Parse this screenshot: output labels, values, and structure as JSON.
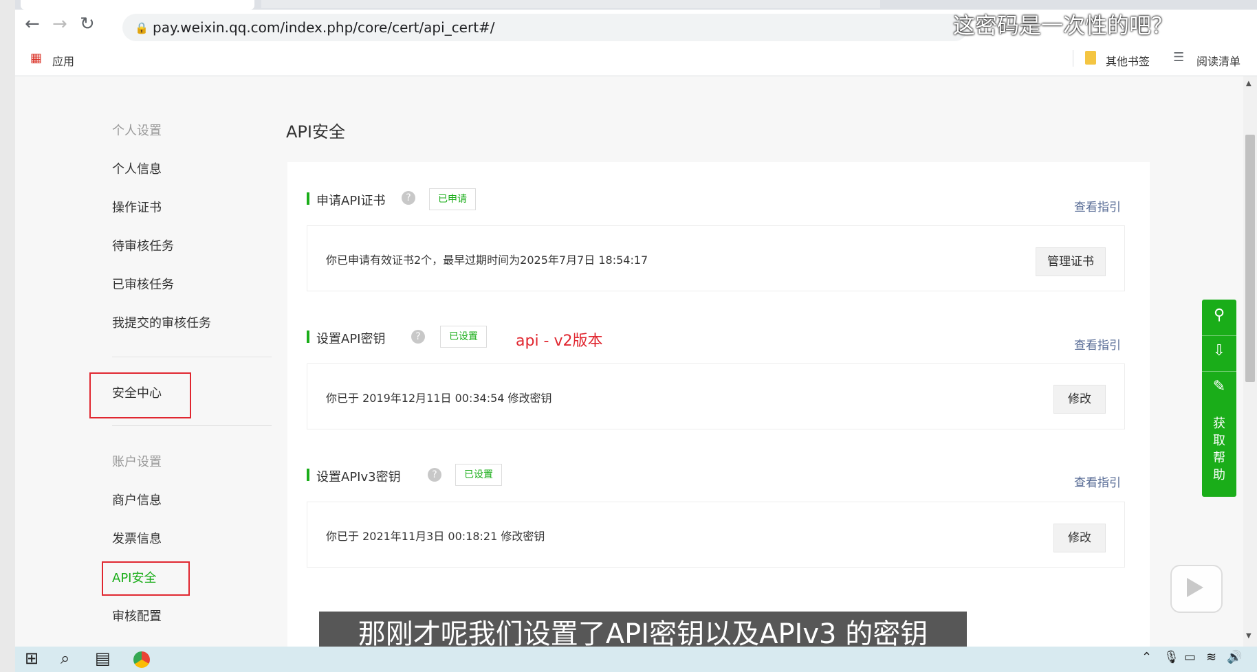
{
  "browser": {
    "url": "pay.weixin.qq.com/index.php/core/cert/api_cert#/",
    "bookmarks": {
      "apps": "应用",
      "other": "其他书签",
      "reading_list": "阅读清单"
    }
  },
  "sidebar": {
    "section1_heading": "个人设置",
    "items1": [
      "个人信息",
      "操作证书",
      "待审核任务",
      "已审核任务",
      "我提交的审核任务"
    ],
    "security_center": "安全中心",
    "section2_heading": "账户设置",
    "items2": [
      "商户信息",
      "发票信息",
      "API安全",
      "审核配置"
    ]
  },
  "main": {
    "title": "API安全",
    "sections": [
      {
        "title": "申请API证书",
        "tag": "已申请",
        "guide": "查看指引",
        "info": "你已申请有效证书2个，最早过期时间为2025年7月7日 18:54:17",
        "button": "管理证书"
      },
      {
        "title": "设置API密钥",
        "tag": "已设置",
        "guide": "查看指引",
        "info": "你已于 2019年12月11日 00:34:54 修改密钥",
        "button": "修改"
      },
      {
        "title": "设置APIv3密钥",
        "tag": "已设置",
        "guide": "查看指引",
        "info": "你已于 2021年11月3日 00:18:21 修改密钥",
        "button": "修改"
      }
    ],
    "annotation": "api - v2版本"
  },
  "help_float": {
    "label": "获取帮助"
  },
  "overlay": {
    "subtitle": "那刚才呢我们设置了API密钥以及APIv3 的密钥",
    "top_watermark": "这密码是一次性的吧？"
  },
  "colors": {
    "accent_green": "#1aad19",
    "annotation_red": "#e0262f",
    "link_blue": "#576b95"
  },
  "icons": [
    "back-arrow-icon",
    "forward-arrow-icon",
    "reload-icon",
    "lock-icon",
    "apps-grid-icon",
    "bookmark-folder-icon",
    "reading-list-icon",
    "link-icon",
    "download-icon",
    "edit-icon",
    "play-icon",
    "windows-start-icon",
    "search-icon",
    "task-view-icon",
    "chrome-icon"
  ]
}
